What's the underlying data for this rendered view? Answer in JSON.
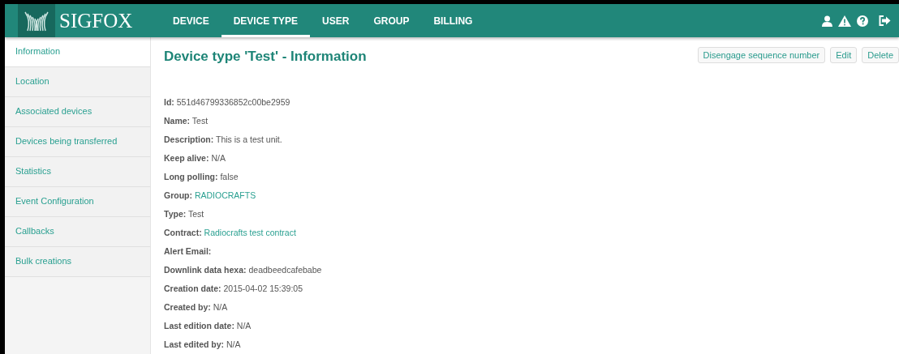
{
  "header": {
    "logo": "SIGFOX",
    "nav": [
      {
        "label": "DEVICE",
        "selected": false
      },
      {
        "label": "DEVICE TYPE",
        "selected": true
      },
      {
        "label": "USER",
        "selected": false
      },
      {
        "label": "GROUP",
        "selected": false
      },
      {
        "label": "BILLING",
        "selected": false
      }
    ]
  },
  "sidebar": {
    "items": [
      {
        "label": "Information",
        "selected": true
      },
      {
        "label": "Location",
        "selected": false
      },
      {
        "label": "Associated devices",
        "selected": false
      },
      {
        "label": "Devices being transferred",
        "selected": false
      },
      {
        "label": "Statistics",
        "selected": false
      },
      {
        "label": "Event Configuration",
        "selected": false
      },
      {
        "label": "Callbacks",
        "selected": false
      },
      {
        "label": "Bulk creations",
        "selected": false
      }
    ]
  },
  "content": {
    "title": "Device type 'Test' - Information",
    "buttons": [
      "Disengage sequence number",
      "Edit",
      "Delete"
    ],
    "fields": [
      {
        "label": "Id:",
        "value": "551d46799336852c00be2959",
        "kind": "text"
      },
      {
        "label": "Name:",
        "value": "Test",
        "kind": "text"
      },
      {
        "label": "Description:",
        "value": "This is a test unit.",
        "kind": "text"
      },
      {
        "label": "Keep alive:",
        "value": "N/A",
        "kind": "text"
      },
      {
        "label": "Long polling:",
        "value": "false",
        "kind": "text"
      },
      {
        "label": "Group:",
        "value": "RADIOCRAFTS",
        "kind": "link"
      },
      {
        "label": "Type:",
        "value": "Test",
        "kind": "text"
      },
      {
        "label": "Contract:",
        "value": "Radiocrafts test contract",
        "kind": "link"
      },
      {
        "label": "Alert Email:"
      },
      {
        "label": "Downlink data hexa:",
        "value": "deadbeedcafebabe",
        "kind": "text"
      },
      {
        "label": "Creation date:",
        "value": "2015-04-02 15:39:05",
        "kind": "text"
      },
      {
        "label": "Created by:",
        "value": "N/A",
        "kind": "text"
      },
      {
        "label": "Last edition date:",
        "value": "N/A",
        "kind": "text"
      },
      {
        "label": "Last edited by:",
        "value": "N/A",
        "kind": "text"
      }
    ]
  }
}
